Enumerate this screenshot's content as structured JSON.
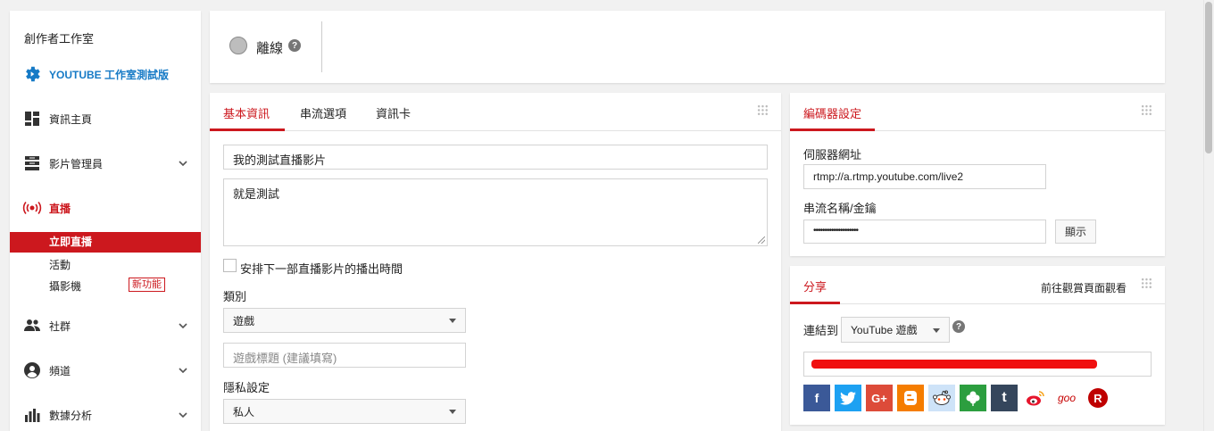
{
  "sidebar": {
    "title": "創作者工作室",
    "brand": "YOUTUBE 工作室測試版",
    "items": [
      {
        "label": "資訊主頁"
      },
      {
        "label": "影片管理員"
      },
      {
        "label": "直播"
      },
      {
        "label": "社群"
      },
      {
        "label": "頻道"
      },
      {
        "label": "數據分析"
      }
    ],
    "live_sub": {
      "active": "立即直播",
      "events": "活動",
      "camera": "攝影機",
      "new_badge": "新功能"
    }
  },
  "status": {
    "label": "離線",
    "help": "?"
  },
  "info": {
    "tabs": [
      "基本資訊",
      "串流選項",
      "資訊卡"
    ],
    "title_value": "我的測試直播影片",
    "description_value": "就是測試",
    "schedule_label": "安排下一部直播影片的播出時間",
    "category_label": "類別",
    "category_value": "遊戲",
    "game_title_placeholder": "遊戲標題 (建議填寫)",
    "privacy_label": "隱私設定",
    "privacy_value": "私人"
  },
  "encoder": {
    "tab": "編碼器設定",
    "server_label": "伺服器網址",
    "server_value": "rtmp://a.rtmp.youtube.com/live2",
    "key_label": "串流名稱/金鑰",
    "key_value": "••••••••••••••••••••",
    "show_button": "顯示"
  },
  "share": {
    "tab": "分享",
    "watch_link": "前往觀賞頁面觀看",
    "connect_label": "連結到",
    "connect_value": "YouTube 遊戲",
    "help": "?",
    "social": [
      {
        "name": "facebook-icon",
        "glyph": "f",
        "color": "#3b5998"
      },
      {
        "name": "twitter-icon",
        "glyph": "t",
        "color": "#1da1f2"
      },
      {
        "name": "google-plus-icon",
        "glyph": "G+",
        "color": "#dd4b39"
      },
      {
        "name": "blogger-icon",
        "glyph": "B",
        "color": "#f57d00"
      },
      {
        "name": "reddit-icon",
        "glyph": "r",
        "color": "#cee3f8"
      },
      {
        "name": "odnoklassniki-icon",
        "glyph": "✿",
        "color": "#2c9e3f"
      },
      {
        "name": "tumblr-icon",
        "glyph": "t",
        "color": "#35465c"
      },
      {
        "name": "weibo-icon",
        "glyph": "微",
        "color": "#ffffff"
      },
      {
        "name": "goo-icon",
        "glyph": "goo",
        "color": "#ffffff"
      },
      {
        "name": "rakuten-icon",
        "glyph": "R",
        "color": "#bf0000"
      }
    ]
  },
  "colors": {
    "accent": "#cc181e",
    "brand_blue": "#167ac6"
  }
}
